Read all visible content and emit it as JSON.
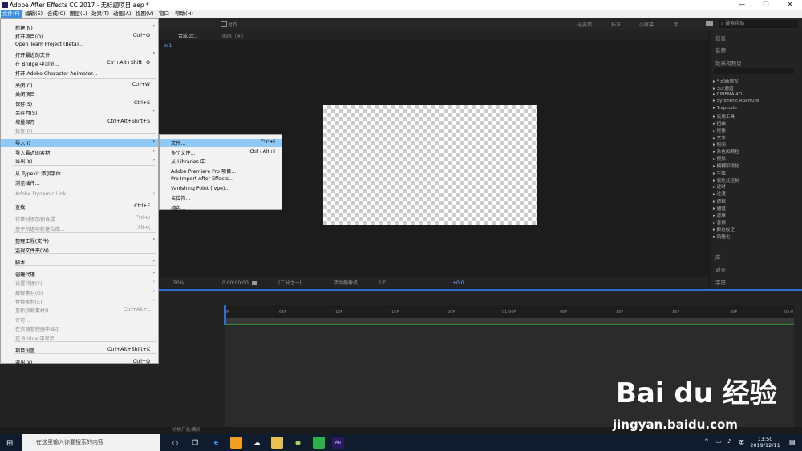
{
  "window": {
    "title": "Adobe After Effects CC 2017 - 无标题项目.aep *",
    "min": "—",
    "max": "❐",
    "close": "✕"
  },
  "menubar": [
    "文件(F)",
    "编辑(E)",
    "合成(C)",
    "图层(L)",
    "效果(T)",
    "动画(A)",
    "视图(V)",
    "窗口",
    "帮助(H)"
  ],
  "toolbar": {
    "align_label": "对齐",
    "workspaces": [
      "必要项",
      "标准",
      "小屏幕",
      "库"
    ],
    "search_placeholder": "搜索帮助"
  },
  "comp": {
    "tab_label": "合成 zc1",
    "layer_tab": "图层（无）",
    "breadcrumb": "zc1"
  },
  "viewer": {
    "zoom": "50%",
    "timecode": "0:00:00:00",
    "resolution": "(二分之一)",
    "camera": "活动摄像机",
    "views": "1个...",
    "exposure": "+0.0"
  },
  "right_panel": {
    "info": "信息",
    "audio": "音频",
    "effects_title": "效果和预设",
    "effects": [
      "* 动画预设",
      "3D 通道",
      "CINEMA 4D",
      "Synthetic Aperture",
      "Trapcode",
      "实用工具",
      "扭曲",
      "抠像",
      "文本",
      "时间",
      "杂色和颗粒",
      "模拟",
      "模糊和锐化",
      "生成",
      "表达式控制",
      "过时",
      "过渡",
      "透视",
      "通道",
      "遮罩",
      "音频",
      "颜色校正",
      "风格化"
    ],
    "library": "库",
    "align": "对齐",
    "character": "字符"
  },
  "file_menu": [
    {
      "label": "新建(N)",
      "shortcut": "",
      "submenu": true,
      "disabled": false
    },
    {
      "label": "打开项目(O)...",
      "shortcut": "Ctrl+O",
      "submenu": false,
      "disabled": false
    },
    {
      "label": "Open Team Project (Beta)...",
      "shortcut": "",
      "submenu": false,
      "disabled": false
    },
    {
      "label": "打开最近的文件",
      "shortcut": "",
      "submenu": true,
      "disabled": false
    },
    {
      "label": "在 Bridge 中浏览...",
      "shortcut": "Ctrl+Alt+Shift+O",
      "submenu": false,
      "disabled": false
    },
    {
      "label": "打开 Adobe Character Animator...",
      "shortcut": "",
      "submenu": false,
      "disabled": false
    },
    {
      "label": "关闭(C)",
      "shortcut": "Ctrl+W",
      "submenu": false,
      "disabled": false
    },
    {
      "label": "关闭项目",
      "shortcut": "",
      "submenu": false,
      "disabled": false
    },
    {
      "label": "保存(S)",
      "shortcut": "Ctrl+S",
      "submenu": false,
      "disabled": false
    },
    {
      "label": "另存为(S)",
      "shortcut": "",
      "submenu": true,
      "disabled": false
    },
    {
      "label": "增量保存",
      "shortcut": "Ctrl+Alt+Shift+S",
      "submenu": false,
      "disabled": false
    },
    {
      "label": "恢复(R)",
      "shortcut": "",
      "submenu": false,
      "disabled": true
    },
    {
      "label": "导入(I)",
      "shortcut": "",
      "submenu": true,
      "disabled": false
    },
    {
      "label": "导入最近的素材",
      "shortcut": "",
      "submenu": true,
      "disabled": false
    },
    {
      "label": "导出(X)",
      "shortcut": "",
      "submenu": true,
      "disabled": false
    },
    {
      "label": "从 Typekit 添加字体...",
      "shortcut": "",
      "submenu": false,
      "disabled": false
    },
    {
      "label": "浏览插件...",
      "shortcut": "",
      "submenu": false,
      "disabled": false
    },
    {
      "label": "Adobe Dynamic Link",
      "shortcut": "",
      "submenu": true,
      "disabled": true
    },
    {
      "label": "查找",
      "shortcut": "Ctrl+F",
      "submenu": false,
      "disabled": false
    },
    {
      "label": "将素材添加到合成",
      "shortcut": "Ctrl+/",
      "submenu": false,
      "disabled": true
    },
    {
      "label": "基于所选项新建合成...",
      "shortcut": "Alt+\\",
      "submenu": false,
      "disabled": true
    },
    {
      "label": "整理工程(文件)",
      "shortcut": "",
      "submenu": true,
      "disabled": false
    },
    {
      "label": "监视文件夹(W)...",
      "shortcut": "",
      "submenu": false,
      "disabled": false
    },
    {
      "label": "脚本",
      "shortcut": "",
      "submenu": true,
      "disabled": false
    },
    {
      "label": "创建代理",
      "shortcut": "",
      "submenu": true,
      "disabled": false
    },
    {
      "label": "设置代理(Y)",
      "shortcut": "",
      "submenu": true,
      "disabled": true
    },
    {
      "label": "解释素材(G)",
      "shortcut": "",
      "submenu": true,
      "disabled": true
    },
    {
      "label": "替换素材(E)",
      "shortcut": "",
      "submenu": true,
      "disabled": true
    },
    {
      "label": "重新加载素材(L)",
      "shortcut": "Ctrl+Alt+L",
      "submenu": false,
      "disabled": true
    },
    {
      "label": "许可...",
      "shortcut": "",
      "submenu": false,
      "disabled": true
    },
    {
      "label": "在资源管理器中显示",
      "shortcut": "",
      "submenu": false,
      "disabled": true
    },
    {
      "label": "在 Bridge 中显示",
      "shortcut": "",
      "submenu": false,
      "disabled": true
    },
    {
      "label": "项目设置...",
      "shortcut": "Ctrl+Alt+Shift+K",
      "submenu": false,
      "disabled": false
    },
    {
      "label": "退出(X)",
      "shortcut": "Ctrl+Q",
      "submenu": false,
      "disabled": false
    }
  ],
  "import_submenu": [
    {
      "label": "文件...",
      "shortcut": "Ctrl+I"
    },
    {
      "label": "多个文件...",
      "shortcut": "Ctrl+Alt+I"
    },
    {
      "label": "从 Libraries 中...",
      "shortcut": ""
    },
    {
      "label": "Adobe Premiere Pro 项目...",
      "shortcut": ""
    },
    {
      "label": "Pro Import After Effects...",
      "shortcut": ""
    },
    {
      "label": "Vanishing Point (.vpe)...",
      "shortcut": ""
    },
    {
      "label": "占位符...",
      "shortcut": ""
    },
    {
      "label": "纯色...",
      "shortcut": ""
    }
  ],
  "timeline": {
    "ticks": [
      "0F",
      "05F",
      "10F",
      "15F",
      "20F",
      "01:00F",
      "05F",
      "10F",
      "15F",
      "20F",
      "02:0"
    ],
    "footer_label": "切换开关/模式"
  },
  "taskbar": {
    "search_placeholder": "在这里输入你要搜索的内容",
    "lang": "英",
    "time": "13:50",
    "date": "2019/12/11"
  },
  "watermark": {
    "logo": "Bai du 经验",
    "url": "jingyan.baidu.com"
  }
}
